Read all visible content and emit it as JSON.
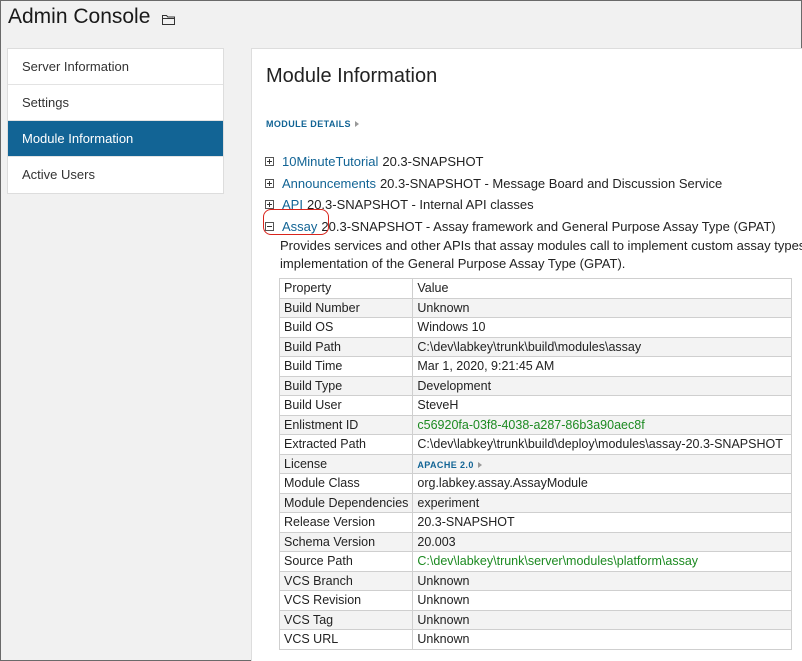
{
  "header": {
    "title": "Admin Console",
    "folder_icon": "folder-icon"
  },
  "sidebar": {
    "active_color": "#126495",
    "items": [
      {
        "label": "Server Information",
        "active": false
      },
      {
        "label": "Settings",
        "active": false
      },
      {
        "label": "Module Information",
        "active": true
      },
      {
        "label": "Active Users",
        "active": false
      }
    ]
  },
  "main": {
    "title": "Module Information",
    "section_link": "MODULE DETAILS",
    "modules": [
      {
        "name": "10MinuteTutorial",
        "desc": "20.3-SNAPSHOT",
        "expanded": false
      },
      {
        "name": "Announcements",
        "desc": "20.3-SNAPSHOT - Message Board and Discussion Service",
        "expanded": false
      },
      {
        "name": "API",
        "desc": "20.3-SNAPSHOT - Internal API classes",
        "expanded": false
      },
      {
        "name": "Assay",
        "desc": "20.3-SNAPSHOT - Assay framework and General Purpose Assay Type (GPAT)",
        "expanded": true
      }
    ],
    "assay_description": "Provides services and other APIs that assay modules call to implement custom assay types. implementation of the General Purpose Assay Type (GPAT).",
    "properties": {
      "headers": [
        "Property",
        "Value"
      ],
      "rows": [
        [
          "Build Number",
          "Unknown"
        ],
        [
          "Build OS",
          "Windows 10"
        ],
        [
          "Build Path",
          "C:\\dev\\labkey\\trunk\\build\\modules\\assay"
        ],
        [
          "Build Time",
          "Mar 1, 2020, 9:21:45 AM"
        ],
        [
          "Build Type",
          "Development"
        ],
        [
          "Build User",
          "SteveH"
        ],
        [
          "Enlistment ID",
          "c56920fa-03f8-4038-a287-86b3a90aec8f"
        ],
        [
          "Extracted Path",
          "C:\\dev\\labkey\\trunk\\build\\deploy\\modules\\assay-20.3-SNAPSHOT"
        ],
        [
          "License",
          "APACHE 2.0"
        ],
        [
          "Module Class",
          "org.labkey.assay.AssayModule"
        ],
        [
          "Module Dependencies",
          "experiment"
        ],
        [
          "Release Version",
          "20.3-SNAPSHOT"
        ],
        [
          "Schema Version",
          "20.003"
        ],
        [
          "Source Path",
          "C:\\dev\\labkey\\trunk\\server\\modules\\platform\\assay"
        ],
        [
          "VCS Branch",
          "Unknown"
        ],
        [
          "VCS Revision",
          "Unknown"
        ],
        [
          "VCS Tag",
          "Unknown"
        ],
        [
          "VCS URL",
          "Unknown"
        ]
      ]
    },
    "link_color": "#126495",
    "green_color": "#1c8a21",
    "highlight_color": "#d9241c"
  }
}
